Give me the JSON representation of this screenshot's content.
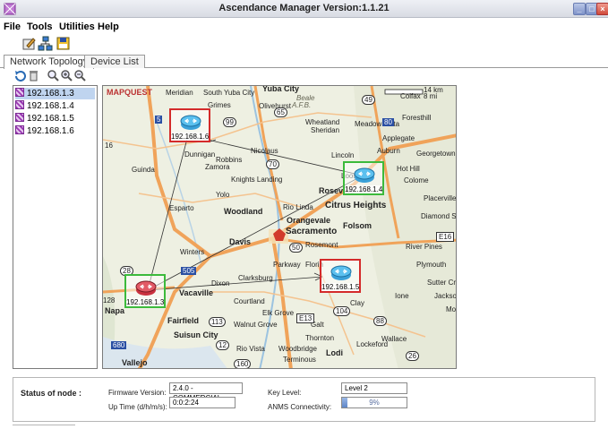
{
  "window": {
    "title": "Ascendance Manager  Version:1.1.21"
  },
  "menu": [
    "File",
    "Tools",
    "Utilities",
    "Help"
  ],
  "toolbar": {
    "icons": [
      "edit-icon",
      "network-icon",
      "save-icon"
    ]
  },
  "tabs": [
    {
      "label": "Network Topology",
      "active": true
    },
    {
      "label": "Device List",
      "active": false
    }
  ],
  "map_toolbar": {
    "icons": [
      "refresh-icon",
      "delete-icon",
      "zoom-fit-icon",
      "zoom-in-icon",
      "zoom-out-icon"
    ]
  },
  "tree": {
    "items": [
      {
        "label": "192.168.1.3",
        "selected": true
      },
      {
        "label": "192.168.1.4",
        "selected": false
      },
      {
        "label": "192.168.1.5",
        "selected": false
      },
      {
        "label": "192.168.1.6",
        "selected": false
      }
    ]
  },
  "map": {
    "brand": "MAPQUEST",
    "scale": {
      "km": "14 km",
      "mi": "8 mi"
    },
    "places": [
      "Meridian",
      "South Yuba City",
      "Yuba City",
      "Beale",
      "A.F.B.",
      "Grimes",
      "Olivehurst",
      "Wheatland",
      "Meadow Vista",
      "Foresthill",
      "Colfax",
      "Sheridan",
      "Applegate",
      "Nicolaus",
      "Lincoln",
      "Auburn",
      "Georgetown",
      "Dunnigan",
      "Robbins",
      "Guinda",
      "Zamora",
      "Knights Landing",
      "Yolo",
      "Loomis",
      "Roseville",
      "Colome",
      "Placerville",
      "Esparto",
      "Woodland",
      "Rio Linda",
      "Citrus Heights",
      "Orangevale",
      "Folsom",
      "Diamond S",
      "Davis",
      "Sacramento",
      "Winters",
      "Rosemont",
      "River Pines",
      "Parkway",
      "Florin",
      "Plymouth",
      "Dixon",
      "Clarksburg",
      "Sutter Cree",
      "Ione",
      "Jackson",
      "Vacaville",
      "Courtland",
      "Elk Grove",
      "Clay",
      "Napa",
      "Fairfield",
      "Walnut Grove",
      "Galt",
      "Mount",
      "Suisun City",
      "Thornton",
      "Wallace",
      "Rio Vista",
      "Woodbridge",
      "Lodi",
      "Lockeford",
      "Vallejo",
      "Terminous",
      "Hot Hill"
    ],
    "highways": [
      "5",
      "65",
      "49",
      "80",
      "99",
      "70",
      "16",
      "50",
      "505",
      "113",
      "12",
      "104",
      "88",
      "26",
      "160",
      "680",
      "E16",
      "E13",
      "28",
      "128"
    ],
    "devices": [
      {
        "ip": "192.168.1.6",
        "status": "red"
      },
      {
        "ip": "192.168.1.4",
        "status": "green"
      },
      {
        "ip": "192.168.1.3",
        "status": "green"
      },
      {
        "ip": "192.168.1.5",
        "status": "red"
      }
    ]
  },
  "status": {
    "heading": "Status of node :",
    "firmware_label": "Firmware Version:",
    "firmware_value": "2.4.0 - COMMERCIAL",
    "uptime_label": "Up Time (d/h/m/s):",
    "uptime_value": "0:0:2:24",
    "key_label": "Key Level:",
    "key_value": "Level 2",
    "anms_label": "ANMS Connectivity:",
    "anms_value": "9%",
    "anms_percent": 9
  },
  "colors": {
    "accent": "#7f93c9",
    "device_ok": "#3cba3c",
    "device_bad": "#d42b2b"
  }
}
